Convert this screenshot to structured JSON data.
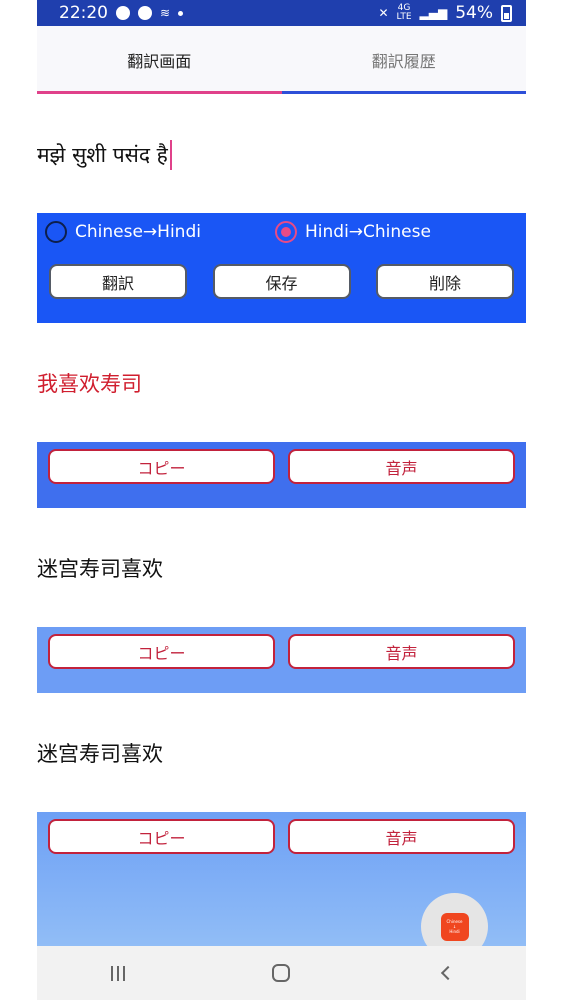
{
  "status_bar": {
    "time": "22:20",
    "network_top": "4G",
    "network_bottom": "LTE",
    "battery": "54%"
  },
  "tabs": [
    {
      "label": "翻訳画面",
      "active": true
    },
    {
      "label": "翻訳履歴",
      "active": false
    }
  ],
  "input": {
    "text": "मझे सुशी पसंद है"
  },
  "direction": {
    "options": [
      {
        "label": "Chinese→Hindi",
        "checked": false
      },
      {
        "label": "Hindi→Chinese",
        "checked": true
      }
    ]
  },
  "actions": {
    "translate": "翻訳",
    "save": "保存",
    "delete": "削除"
  },
  "results": [
    {
      "text": "我喜欢寿司",
      "copy_label": "コピー",
      "voice_label": "音声"
    },
    {
      "text": "迷宫寿司喜欢",
      "copy_label": "コピー",
      "voice_label": "音声"
    },
    {
      "text": "迷宫寿司喜欢",
      "copy_label": "コピー",
      "voice_label": "音声"
    }
  ],
  "fab": {
    "line1": "Chinese",
    "line2": "↓",
    "line3": "Hindi"
  },
  "colors": {
    "accent": "#e0418a",
    "panel_blue": "#1a56f5",
    "result_red": "#d01e2e",
    "button_border_red": "#c2223c"
  },
  "icons": {
    "status": [
      "messenger-icon",
      "chrome-icon",
      "signal-cast-icon",
      "mute-icon",
      "cell-signal-icon",
      "battery-icon"
    ],
    "nav": [
      "recent-apps-icon",
      "home-icon",
      "back-icon"
    ]
  }
}
